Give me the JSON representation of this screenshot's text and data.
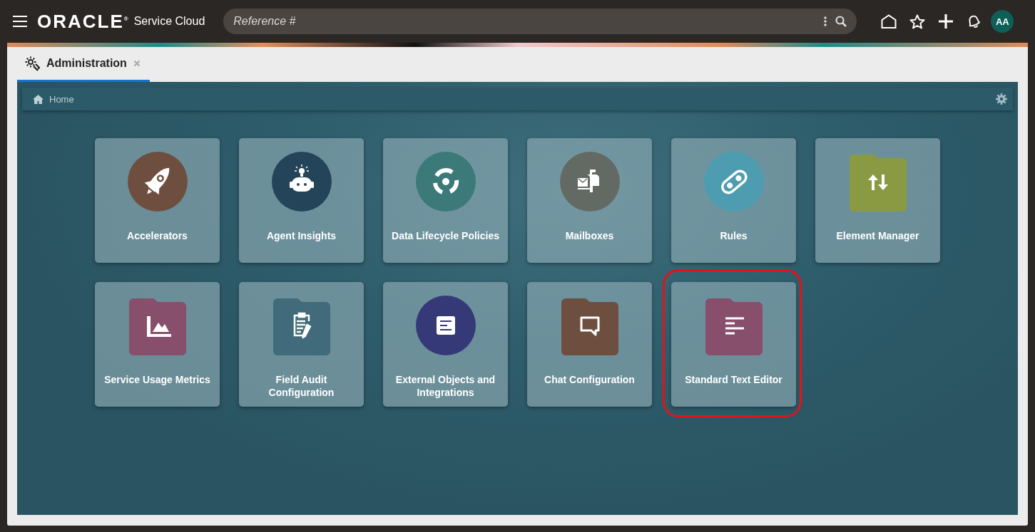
{
  "header": {
    "brand": "ORACLE$^{®}$",
    "product": "Service Cloud",
    "search": {
      "placeholder": "Reference #"
    },
    "avatar": "AA"
  },
  "tabs": [
    {
      "label": "Administration",
      "selected": true
    }
  ],
  "breadcrumb": "Home",
  "tiles": [
    {
      "label": "Accelerators",
      "kind": "circle",
      "color": "#6e4f3f",
      "highlighted": false
    },
    {
      "label": "Agent Insights",
      "kind": "circle",
      "color": "#234459",
      "highlighted": false
    },
    {
      "label": "Data Lifecycle Policies",
      "kind": "circle",
      "color": "#3b7a78",
      "highlighted": false
    },
    {
      "label": "Mailboxes",
      "kind": "circle",
      "color": "#636a63",
      "highlighted": false
    },
    {
      "label": "Rules",
      "kind": "circle",
      "color": "#4e9caf",
      "highlighted": false
    },
    {
      "label": "Element Manager",
      "kind": "folder",
      "color": "#8a9a42",
      "highlighted": false
    },
    {
      "label": "Service Usage Metrics",
      "kind": "folder",
      "color": "#884f6c",
      "highlighted": false
    },
    {
      "label": "Field Audit Configuration",
      "kind": "folder",
      "color": "#416b7a",
      "highlighted": false
    },
    {
      "label": "External Objects and Integrations",
      "kind": "circle",
      "color": "#353978",
      "highlighted": false
    },
    {
      "label": "Chat Configuration",
      "kind": "folder",
      "color": "#6e4f3f",
      "highlighted": false
    },
    {
      "label": "Standard Text Editor",
      "kind": "folder",
      "color": "#884f6c",
      "highlighted": true
    }
  ]
}
